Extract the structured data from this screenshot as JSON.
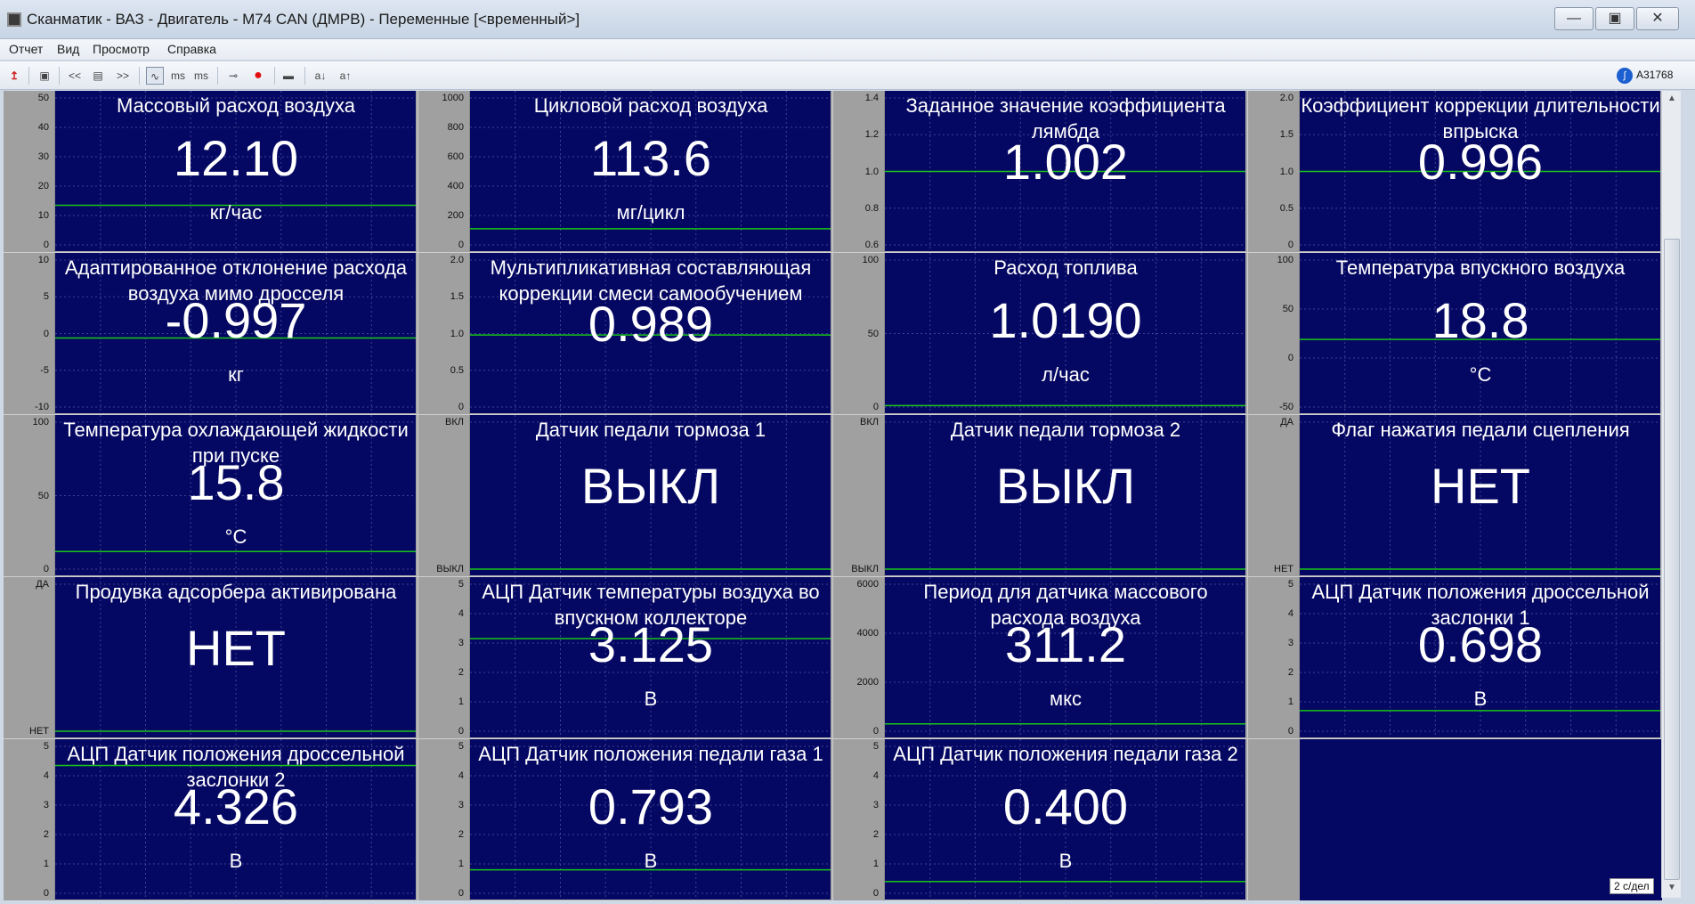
{
  "window": {
    "title": "Сканматик - ВАЗ - Двигатель - M74 CAN (ДМРВ) - Переменные [<временный>]",
    "minimize_icon": "minimize-icon",
    "maximize_icon": "maximize-icon",
    "close_icon": "close-icon"
  },
  "menu": [
    {
      "label": "Отчет"
    },
    {
      "label": "Вид"
    },
    {
      "label": "Просмотр"
    },
    {
      "label": "Справка"
    }
  ],
  "toolbar": {
    "items": [
      {
        "icon": "upload-arrow-icon",
        "glyph": "↥"
      },
      {
        "icon": "report-icon",
        "glyph": "▣"
      },
      {
        "icon": "prev-icon",
        "glyph": "<<"
      },
      {
        "icon": "list-icon",
        "glyph": "▤"
      },
      {
        "icon": "next-icon",
        "glyph": ">>"
      },
      {
        "icon": "wave-icon",
        "glyph": "∿"
      },
      {
        "icon": "ms-down-icon",
        "glyph": "ms"
      },
      {
        "icon": "ms-up-icon",
        "glyph": "ms"
      },
      {
        "icon": "connect-icon",
        "glyph": "⊸"
      },
      {
        "icon": "record-icon",
        "glyph": "●"
      },
      {
        "icon": "save-icon",
        "glyph": "▬"
      },
      {
        "icon": "font-down-icon",
        "glyph": "a↓"
      },
      {
        "icon": "font-up-icon",
        "glyph": "a↑"
      }
    ],
    "device_icon": "bluetooth-icon",
    "device_label": "A31768"
  },
  "tiles": [
    {
      "title": "Массовый расход воздуха",
      "value": "12.10",
      "unit": "кг/час",
      "ticks": [
        "50",
        "40",
        "30",
        "20",
        "10",
        "0"
      ],
      "level": 0.27
    },
    {
      "title": "Цикловой расход воздуха",
      "value": "113.6",
      "unit": "мг/цикл",
      "ticks": [
        "1000",
        "800",
        "600",
        "400",
        "200",
        "0"
      ],
      "level": 0.11
    },
    {
      "title": "Заданное значение коэффициента лямбда",
      "value": "1.002",
      "unit": "",
      "ticks": [
        "1.4",
        "1.2",
        "1.0",
        "0.8",
        "0.6"
      ],
      "level": 0.5
    },
    {
      "title": "Коэффициент коррекции длительности впрыска",
      "value": "0.996",
      "unit": "",
      "ticks": [
        "2.0",
        "1.5",
        "1.0",
        "0.5",
        "0"
      ],
      "level": 0.5
    },
    {
      "title": "Адаптированное отклонение расхода воздуха мимо дросселя",
      "value": "-0.997",
      "unit": "кг",
      "ticks": [
        "10",
        "5",
        "0",
        "-5",
        "-10"
      ],
      "level": 0.47
    },
    {
      "title": "Мультипликативная составляющая коррекции смеси самообучением",
      "value": "0.989",
      "unit": "",
      "ticks": [
        "2.0",
        "1.5",
        "1.0",
        "0.5",
        "0"
      ],
      "level": 0.49
    },
    {
      "title": "Расход топлива",
      "value": "1.0190",
      "unit": "л/час",
      "ticks": [
        "100",
        "50",
        "0"
      ],
      "level": 0.01
    },
    {
      "title": "Температура впускного воздуха",
      "value": "18.8",
      "unit": "°C",
      "ticks": [
        "100",
        "50",
        "0",
        "-50"
      ],
      "level": 0.46
    },
    {
      "title": "Температура охлаждающей жидкости при пуске",
      "value": "15.8",
      "unit": "°C",
      "ticks": [
        "100",
        "50",
        "0"
      ],
      "level": 0.12
    },
    {
      "title": "Датчик педали тормоза 1",
      "value": "ВЫКЛ",
      "unit": "",
      "ticks": [
        "ВКЛ",
        "ВЫКЛ"
      ],
      "level": 0.0
    },
    {
      "title": "Датчик педали тормоза 2",
      "value": "ВЫКЛ",
      "unit": "",
      "ticks": [
        "ВКЛ",
        "ВЫКЛ"
      ],
      "level": 0.0
    },
    {
      "title": "Флаг нажатия педали сцепления",
      "value": "НЕТ",
      "unit": "",
      "ticks": [
        "ДА",
        "НЕТ"
      ],
      "level": 0.0
    },
    {
      "title": "Продувка адсорбера активирована",
      "value": "НЕТ",
      "unit": "",
      "ticks": [
        "ДА",
        "НЕТ"
      ],
      "level": 0.0
    },
    {
      "title": "АЦП Датчик температуры воздуха во впускном коллекторе",
      "value": "3.125",
      "unit": "В",
      "ticks": [
        "5",
        "4",
        "3",
        "2",
        "1",
        "0"
      ],
      "level": 0.63
    },
    {
      "title": "Период для датчика массового расхода воздуха",
      "value": "311.2",
      "unit": "мкс",
      "ticks": [
        "6000",
        "4000",
        "2000",
        "0"
      ],
      "level": 0.05
    },
    {
      "title": "АЦП Датчик положения дроссельной заслонки 1",
      "value": "0.698",
      "unit": "В",
      "ticks": [
        "5",
        "4",
        "3",
        "2",
        "1",
        "0"
      ],
      "level": 0.14
    },
    {
      "title": "АЦП Датчик положения дроссельной заслонки 2",
      "value": "4.326",
      "unit": "В",
      "ticks": [
        "5",
        "4",
        "3",
        "2",
        "1",
        "0"
      ],
      "level": 0.87
    },
    {
      "title": "АЦП Датчик положения педали газа 1",
      "value": "0.793",
      "unit": "В",
      "ticks": [
        "5",
        "4",
        "3",
        "2",
        "1",
        "0"
      ],
      "level": 0.16
    },
    {
      "title": "АЦП Датчик положения педали газа 2",
      "value": "0.400",
      "unit": "В",
      "ticks": [
        "5",
        "4",
        "3",
        "2",
        "1",
        "0"
      ],
      "level": 0.08
    }
  ],
  "speed_label": "2 с/дел",
  "colors": {
    "plot_bg": "#050862",
    "trace": "#19c419",
    "grid": "#3e4190",
    "axis_bg": "#a0a0a0"
  }
}
